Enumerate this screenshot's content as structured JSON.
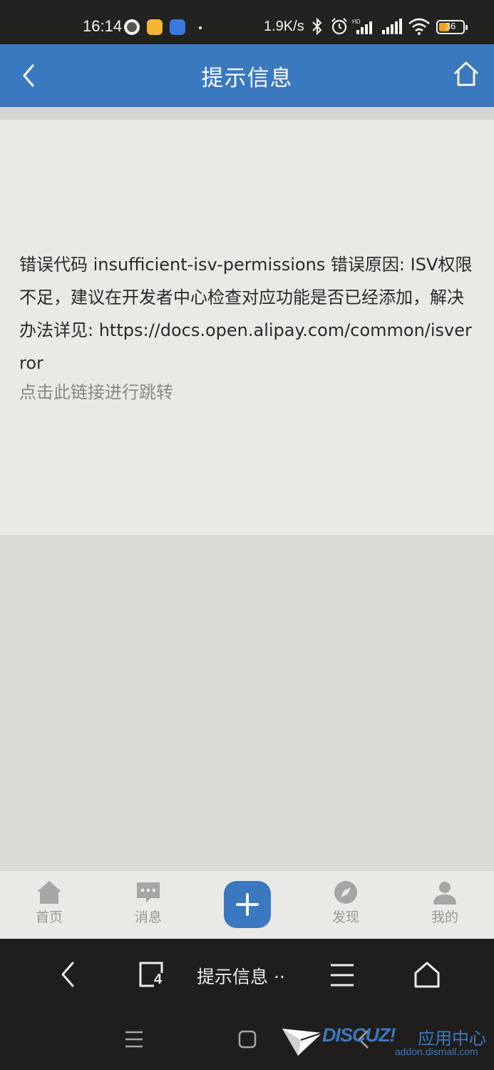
{
  "status_bar": {
    "time": "16:14",
    "network_speed": "1.9K/s",
    "battery": "36"
  },
  "header": {
    "title": "提示信息"
  },
  "content": {
    "message": "错误代码 insufficient-isv-permissions 错误原因: ISV权限不足，建议在开发者中心检查对应功能是否已经添加，解决办法详见: https://docs.open.alipay.com/common/isverror",
    "link_text": "点击此链接进行跳转"
  },
  "tabbar": {
    "items": [
      {
        "label": "首页",
        "icon": "home-icon"
      },
      {
        "label": "消息",
        "icon": "message-icon"
      },
      {
        "label": "",
        "icon": "plus-icon"
      },
      {
        "label": "发现",
        "icon": "compass-icon"
      },
      {
        "label": "我的",
        "icon": "user-icon"
      }
    ]
  },
  "browser_bar": {
    "tab_count": "4",
    "page_title": "提示信息 ··"
  },
  "watermark": {
    "brand": "DISCUZ!",
    "subtitle": "应用中心",
    "url": "addon.dismall.com"
  },
  "colors": {
    "primary": "#3a78c0",
    "status_bar": "#222220",
    "card_bg": "#ebe9e5"
  }
}
